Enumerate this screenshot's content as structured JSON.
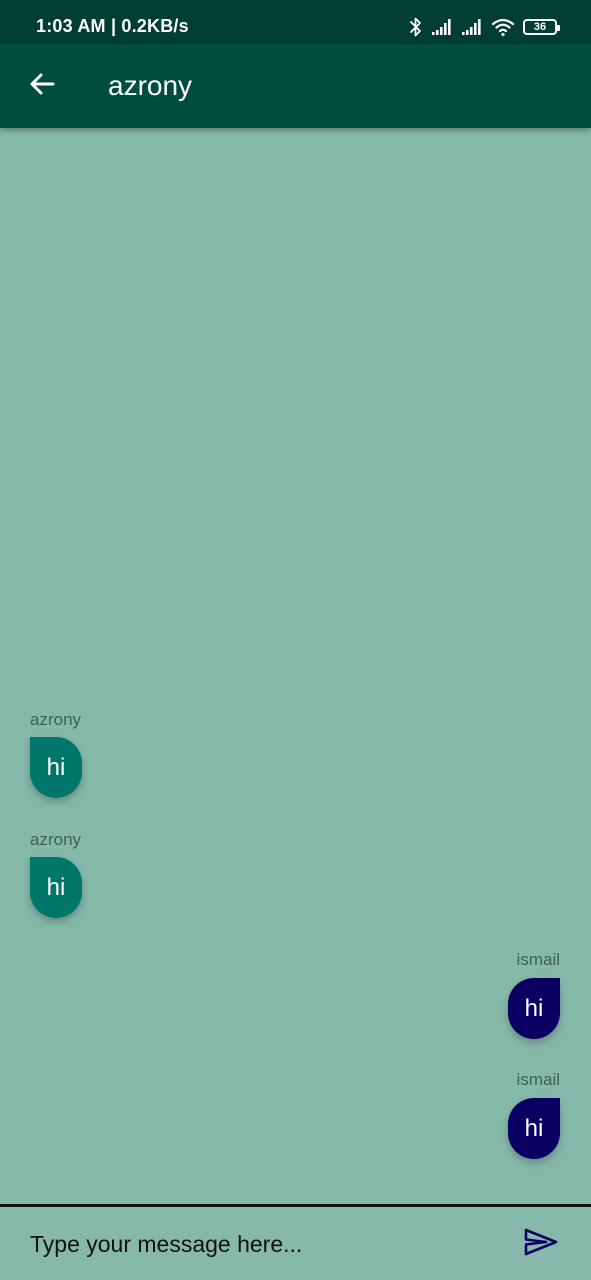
{
  "status_bar": {
    "time": "1:03 AM | 0.2KB/s",
    "battery_level": "36",
    "icons": [
      "bluetooth-icon",
      "signal-icon",
      "signal-icon",
      "wifi-icon",
      "battery-icon"
    ]
  },
  "app_bar": {
    "title": "azrony",
    "back_icon": "arrow-left-icon"
  },
  "messages": [
    {
      "sender": "azrony",
      "text": "hi",
      "side": "left"
    },
    {
      "sender": "azrony",
      "text": "hi",
      "side": "left"
    },
    {
      "sender": "ismail",
      "text": "hi",
      "side": "right"
    },
    {
      "sender": "ismail",
      "text": "hi",
      "side": "right"
    }
  ],
  "composer": {
    "placeholder": "Type your message here...",
    "value": "",
    "send_icon": "send-icon"
  },
  "colors": {
    "status_bar": "#003d33",
    "app_bar": "#004d40",
    "background": "#86b9aa",
    "incoming_bubble": "#00756a",
    "outgoing_bubble": "#0a0063",
    "send_icon": "#0a0063"
  }
}
